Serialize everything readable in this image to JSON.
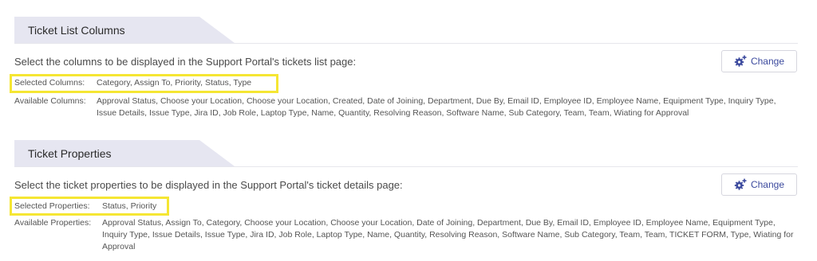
{
  "sections": [
    {
      "title": "Ticket List Columns",
      "description": "Select the columns to be displayed in the Support Portal's tickets list page:",
      "change_label": "Change",
      "selected_label": "Selected Columns:",
      "selected_value": "Category, Assign To, Priority, Status, Type",
      "available_label": "Available Columns:",
      "available_value": "Approval Status, Choose your Location, Choose your Location, Created, Date of Joining, Department, Due By, Email ID, Employee ID, Employee Name, Equipment Type, Inquiry Type, Issue Details, Issue Type, Jira ID, Job Role, Laptop Type, Name, Quantity, Resolving Reason, Software Name, Sub Category, Team, Team, Wiating for Approval"
    },
    {
      "title": "Ticket Properties",
      "description": "Select the ticket properties to be displayed in the Support Portal's ticket details page:",
      "change_label": "Change",
      "selected_label": "Selected Properties:",
      "selected_value": "Status, Priority",
      "available_label": "Available Properties:",
      "available_value": "Approval Status, Assign To, Category, Choose your Location, Choose your Location, Date of Joining, Department, Due By, Email ID, Employee ID, Employee Name, Equipment Type, Inquiry Type, Issue Details, Issue Type, Jira ID, Job Role, Laptop Type, Name, Quantity, Resolving Reason, Software Name, Sub Category, Team, Team, TICKET FORM, Type, Wiating for Approval"
    }
  ],
  "colors": {
    "accent": "#3c4a9e",
    "highlight": "#f5e633",
    "header_tab": "#e6e6f1"
  },
  "icons": {
    "change": "gear-plus-icon"
  }
}
